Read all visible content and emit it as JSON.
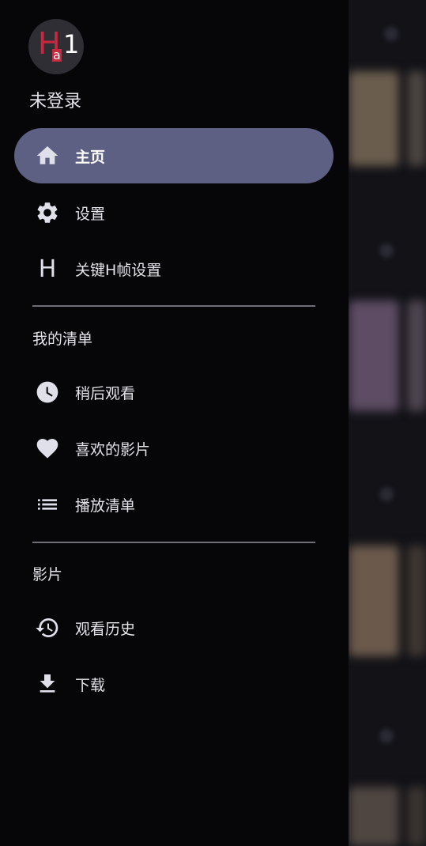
{
  "drawer": {
    "logo": {
      "h": "H",
      "a": "a",
      "one": "1"
    },
    "user_name": "未登录",
    "items_main": [
      {
        "label": "主页",
        "icon": "home-icon",
        "active": true
      },
      {
        "label": "设置",
        "icon": "gear-icon",
        "active": false
      },
      {
        "label": "关键H帧设置",
        "icon": "h-letter-icon",
        "active": false
      }
    ],
    "section_mylist": {
      "title": "我的清单"
    },
    "items_mylist": [
      {
        "label": "稍后观看",
        "icon": "clock-icon"
      },
      {
        "label": "喜欢的影片",
        "icon": "heart-icon"
      },
      {
        "label": "播放清单",
        "icon": "list-icon"
      }
    ],
    "section_films": {
      "title": "影片"
    },
    "items_films": [
      {
        "label": "观看历史",
        "icon": "history-icon"
      },
      {
        "label": "下载",
        "icon": "download-icon"
      }
    ],
    "h_icon_glyph": "H"
  },
  "colors": {
    "active_item": "#5d5f83",
    "drawer_bg": "#060608",
    "logo_accent": "#c4293f"
  }
}
